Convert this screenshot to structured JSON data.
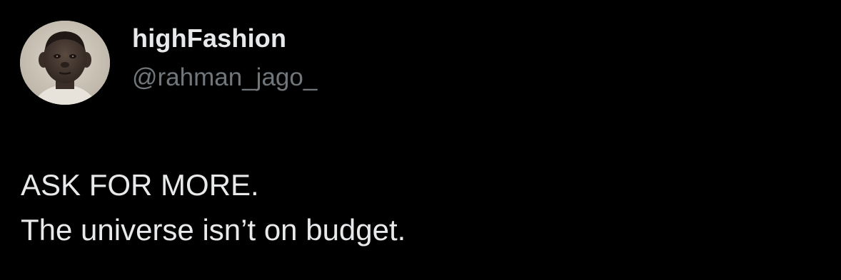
{
  "author": {
    "display_name": "highFashion",
    "handle": "@rahman_jago_",
    "avatar_icon": "profile-photo-child-portrait"
  },
  "tweet": {
    "lines": [
      "ASK FOR MORE.",
      "The universe isn’t on budget."
    ]
  },
  "colors": {
    "background": "#000000",
    "primary_text": "#e7e9ea",
    "secondary_text": "#71767b"
  }
}
